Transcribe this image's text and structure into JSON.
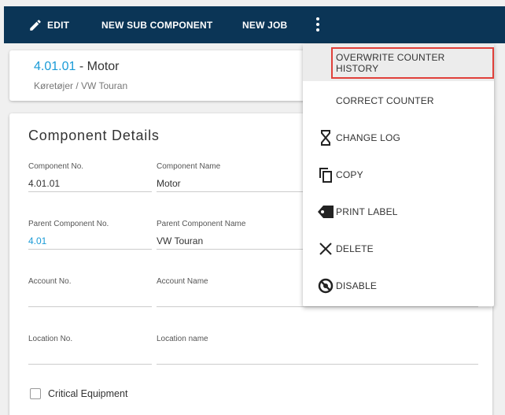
{
  "toolbar": {
    "edit_label": "EDIT",
    "new_sub_component_label": "NEW SUB COMPONENT",
    "new_job_label": "NEW JOB",
    "background_color": "#0b3556"
  },
  "header": {
    "code": "4.01.01",
    "separator": " - ",
    "name": "Motor",
    "breadcrumb": "Køretøjer / VW Touran"
  },
  "details": {
    "title": "Component Details",
    "fields": {
      "component_no": {
        "label": "Component No.",
        "value": "4.01.01"
      },
      "component_name": {
        "label": "Component Name",
        "value": "Motor"
      },
      "parent_component_no": {
        "label": "Parent Component No.",
        "value": "4.01"
      },
      "parent_component_name": {
        "label": "Parent Component Name",
        "value": "VW Touran"
      },
      "account_no": {
        "label": "Account No.",
        "value": ""
      },
      "account_name": {
        "label": "Account Name",
        "value": ""
      },
      "location_no": {
        "label": "Location No.",
        "value": ""
      },
      "location_name": {
        "label": "Location name",
        "value": ""
      }
    },
    "critical_equipment": {
      "label": "Critical Equipment",
      "checked": false
    }
  },
  "menu": {
    "items": [
      {
        "label": "OVERWRITE COUNTER HISTORY",
        "icon": "none",
        "highlighted": true
      },
      {
        "label": "CORRECT COUNTER",
        "icon": "none"
      },
      {
        "label": "CHANGE LOG",
        "icon": "hourglass-icon"
      },
      {
        "label": "COPY",
        "icon": "copy-icon"
      },
      {
        "label": "PRINT LABEL",
        "icon": "tag-icon"
      },
      {
        "label": "DELETE",
        "icon": "close-icon"
      },
      {
        "label": "DISABLE",
        "icon": "disable-icon"
      }
    ],
    "highlight_border_color": "#e0403a"
  },
  "colors": {
    "accent": "#1a9bd7"
  }
}
